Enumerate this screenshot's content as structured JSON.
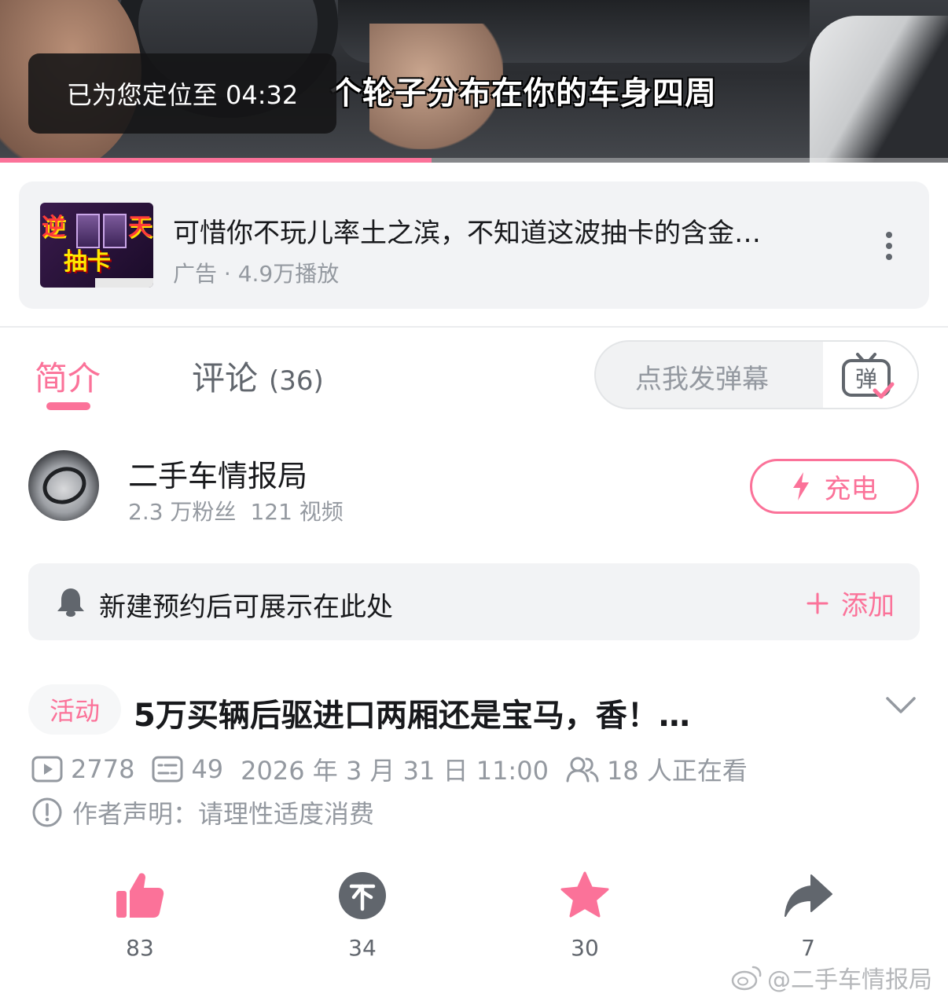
{
  "video": {
    "subtitle": "个轮子分布在你的车身四周",
    "toast": "已为您定位至 04:32",
    "progress_fraction": 0.455
  },
  "ad": {
    "thumbnail_text": [
      "逆",
      "天",
      "抽卡"
    ],
    "title": "可惜你不玩儿率土之滨，不知道这波抽卡的含金…",
    "meta": "广告 · 4.9万播放"
  },
  "tabs": {
    "intro": "简介",
    "comments": "评论",
    "comments_count": "(36)"
  },
  "danmaku": {
    "placeholder": "点我发弹幕",
    "icon_char": "弹"
  },
  "uploader": {
    "name": "二手车情报局",
    "fans": "2.3 万粉丝",
    "videos": "121 视频",
    "charge_label": "充电"
  },
  "reservation": {
    "text": "新建预约后可展示在此处",
    "add_label": "添加"
  },
  "video_info": {
    "tag": "活动",
    "title": "5万买辆后驱进口两厢还是宝马，香！…",
    "plays": "2778",
    "danmaku_count": "49",
    "date": "2026 年 3 月 31 日 11:00",
    "watching": "18 人正在看",
    "declaration": "作者声明：请理性适度消费"
  },
  "actions": {
    "like": "83",
    "coin": "34",
    "favorite": "30",
    "share": "7"
  },
  "watermark": "@二手车情报局",
  "colors": {
    "accent": "#fb7299",
    "text": "#18191c",
    "secondary": "#9499a0"
  }
}
